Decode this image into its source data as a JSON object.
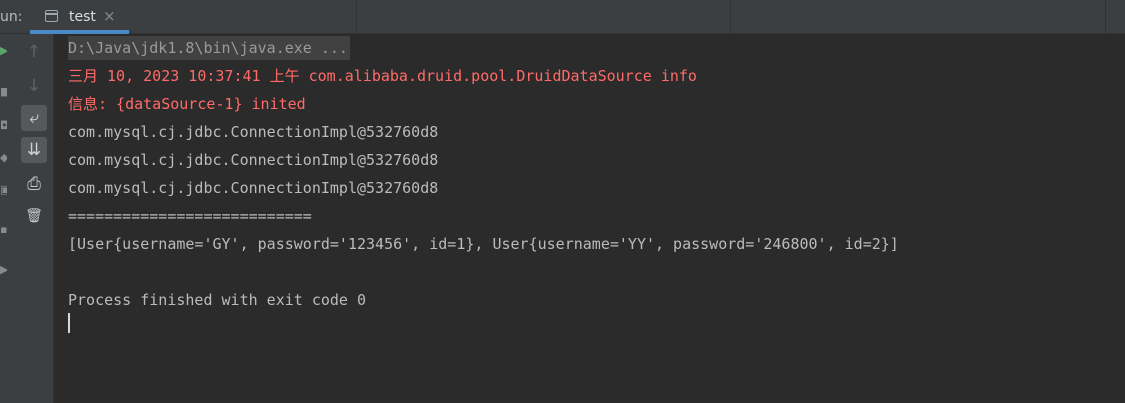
{
  "run_panel": {
    "label": "un:",
    "tab": {
      "title": "test",
      "close": "×"
    }
  },
  "toolbar": {
    "rerun": "▶",
    "up": "↑",
    "down": "↓",
    "soft_wrap": "⤶",
    "scroll_to_end": "⇊",
    "print": "⎙",
    "clear": "🗑"
  },
  "console": {
    "lines": [
      {
        "text": "D:\\Java\\jdk1.8\\bin\\java.exe ...",
        "kind": "command"
      },
      {
        "text": "三月 10, 2023 10:37:41 上午 com.alibaba.druid.pool.DruidDataSource info",
        "kind": "stderr"
      },
      {
        "text": "信息: {dataSource-1} inited",
        "kind": "stderr"
      },
      {
        "text": "com.mysql.cj.jdbc.ConnectionImpl@532760d8",
        "kind": "stdout"
      },
      {
        "text": "com.mysql.cj.jdbc.ConnectionImpl@532760d8",
        "kind": "stdout"
      },
      {
        "text": "com.mysql.cj.jdbc.ConnectionImpl@532760d8",
        "kind": "stdout"
      },
      {
        "text": "===========================",
        "kind": "stdout"
      },
      {
        "text": "[User{username='GY', password='123456', id=1}, User{username='YY', password='246800', id=2}]",
        "kind": "stdout"
      },
      {
        "text": "",
        "kind": "stdout"
      },
      {
        "text": "Process finished with exit code 0",
        "kind": "stdout"
      }
    ]
  },
  "colors": {
    "background": "#2b2b2b",
    "panel": "#3c3f41",
    "stdout": "#bbbbbb",
    "stderr": "#ff6b68",
    "command": "#9a9a9a",
    "tab_accent": "#4a88c7"
  }
}
